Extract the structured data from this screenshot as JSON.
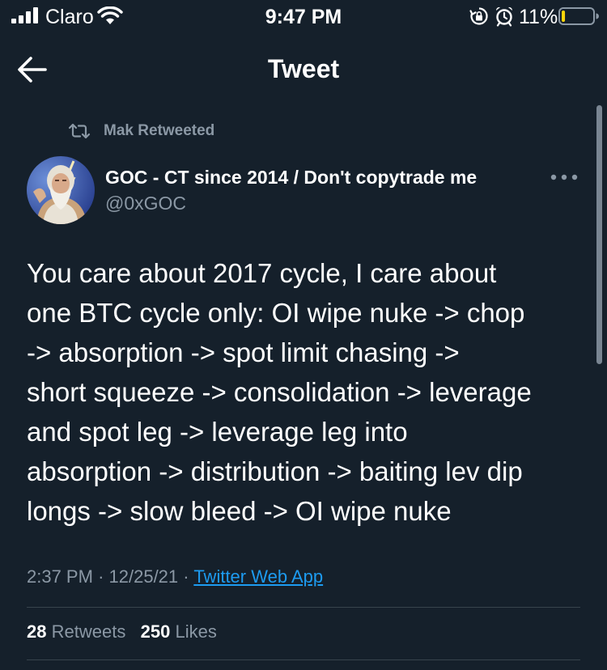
{
  "status_bar": {
    "carrier": "Claro",
    "time": "9:47 PM",
    "battery_percent": "11%",
    "battery_level": 0.11,
    "icons": [
      "signal-bars-icon",
      "wifi-icon",
      "orientation-lock-icon",
      "alarm-clock-icon",
      "battery-icon"
    ]
  },
  "header": {
    "title": "Tweet",
    "back_icon": "arrow-left-icon"
  },
  "tweet": {
    "retweet_context": {
      "label": "Mak Retweeted",
      "icon": "retweet-icon"
    },
    "author": {
      "display_name": "GOC - CT since 2014 / Don't copytrade me",
      "handle": "@0xGOC",
      "avatar": "avatar-zeus-portrait"
    },
    "more_icon": "more-horizontal-icon",
    "text_lines": [
      "You care about 2017 cycle, I care about",
      "one BTC cycle only: OI wipe nuke -> chop",
      "-> absorption -> spot limit chasing ->",
      "short squeeze -> consolidation -> leverage",
      "and spot leg -> leverage leg into",
      "absorption -> distribution -> baiting lev dip",
      "longs -> slow bleed -> OI wipe nuke"
    ],
    "time": "2:37 PM",
    "date": "12/25/21",
    "separator": "·",
    "source": "Twitter Web App",
    "stats": {
      "retweets_count": "28",
      "retweets_label": "Retweets",
      "likes_count": "250",
      "likes_label": "Likes"
    }
  },
  "colors": {
    "background": "#15202b",
    "secondary_text": "#8b98a5",
    "link": "#1d9bf0",
    "divider": "#38444d",
    "battery_low": "#ffd60a"
  }
}
